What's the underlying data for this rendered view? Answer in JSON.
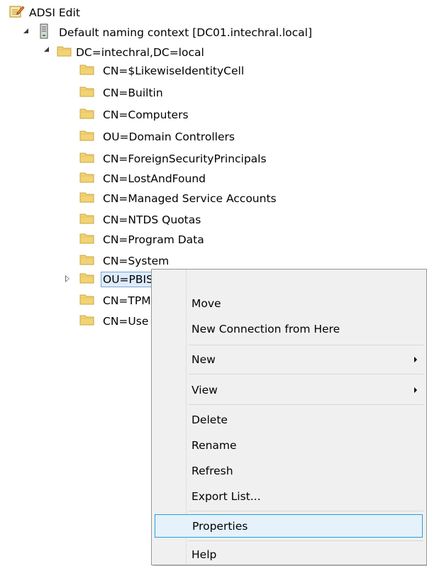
{
  "tree": {
    "root_label": "ADSI Edit",
    "naming_context_label": "Default naming context [DC01.intechral.local]",
    "domain_label": "DC=intechral,DC=local",
    "children": [
      "CN=$LikewiseIdentityCell",
      "CN=Builtin",
      "CN=Computers",
      "OU=Domain Controllers",
      "CN=ForeignSecurityPrincipals",
      "CN=LostAndFound",
      "CN=Managed Service Accounts",
      "CN=NTDS Quotas",
      "CN=Program Data",
      "CN=System",
      "OU=PBIS",
      "CN=TPM",
      "CN=Use"
    ],
    "selected_item": "OU=PBIS"
  },
  "context_menu": {
    "move": "Move",
    "new_connection": "New Connection from Here",
    "new": "New",
    "view": "View",
    "delete": "Delete",
    "rename": "Rename",
    "refresh": "Refresh",
    "export_list": "Export List...",
    "properties": "Properties",
    "help": "Help"
  },
  "colors": {
    "folder": "#f2d374",
    "selection_border": "#7da2ce",
    "menu_hover": "#e5f1fb",
    "menu_hover_border": "#26a0da"
  }
}
